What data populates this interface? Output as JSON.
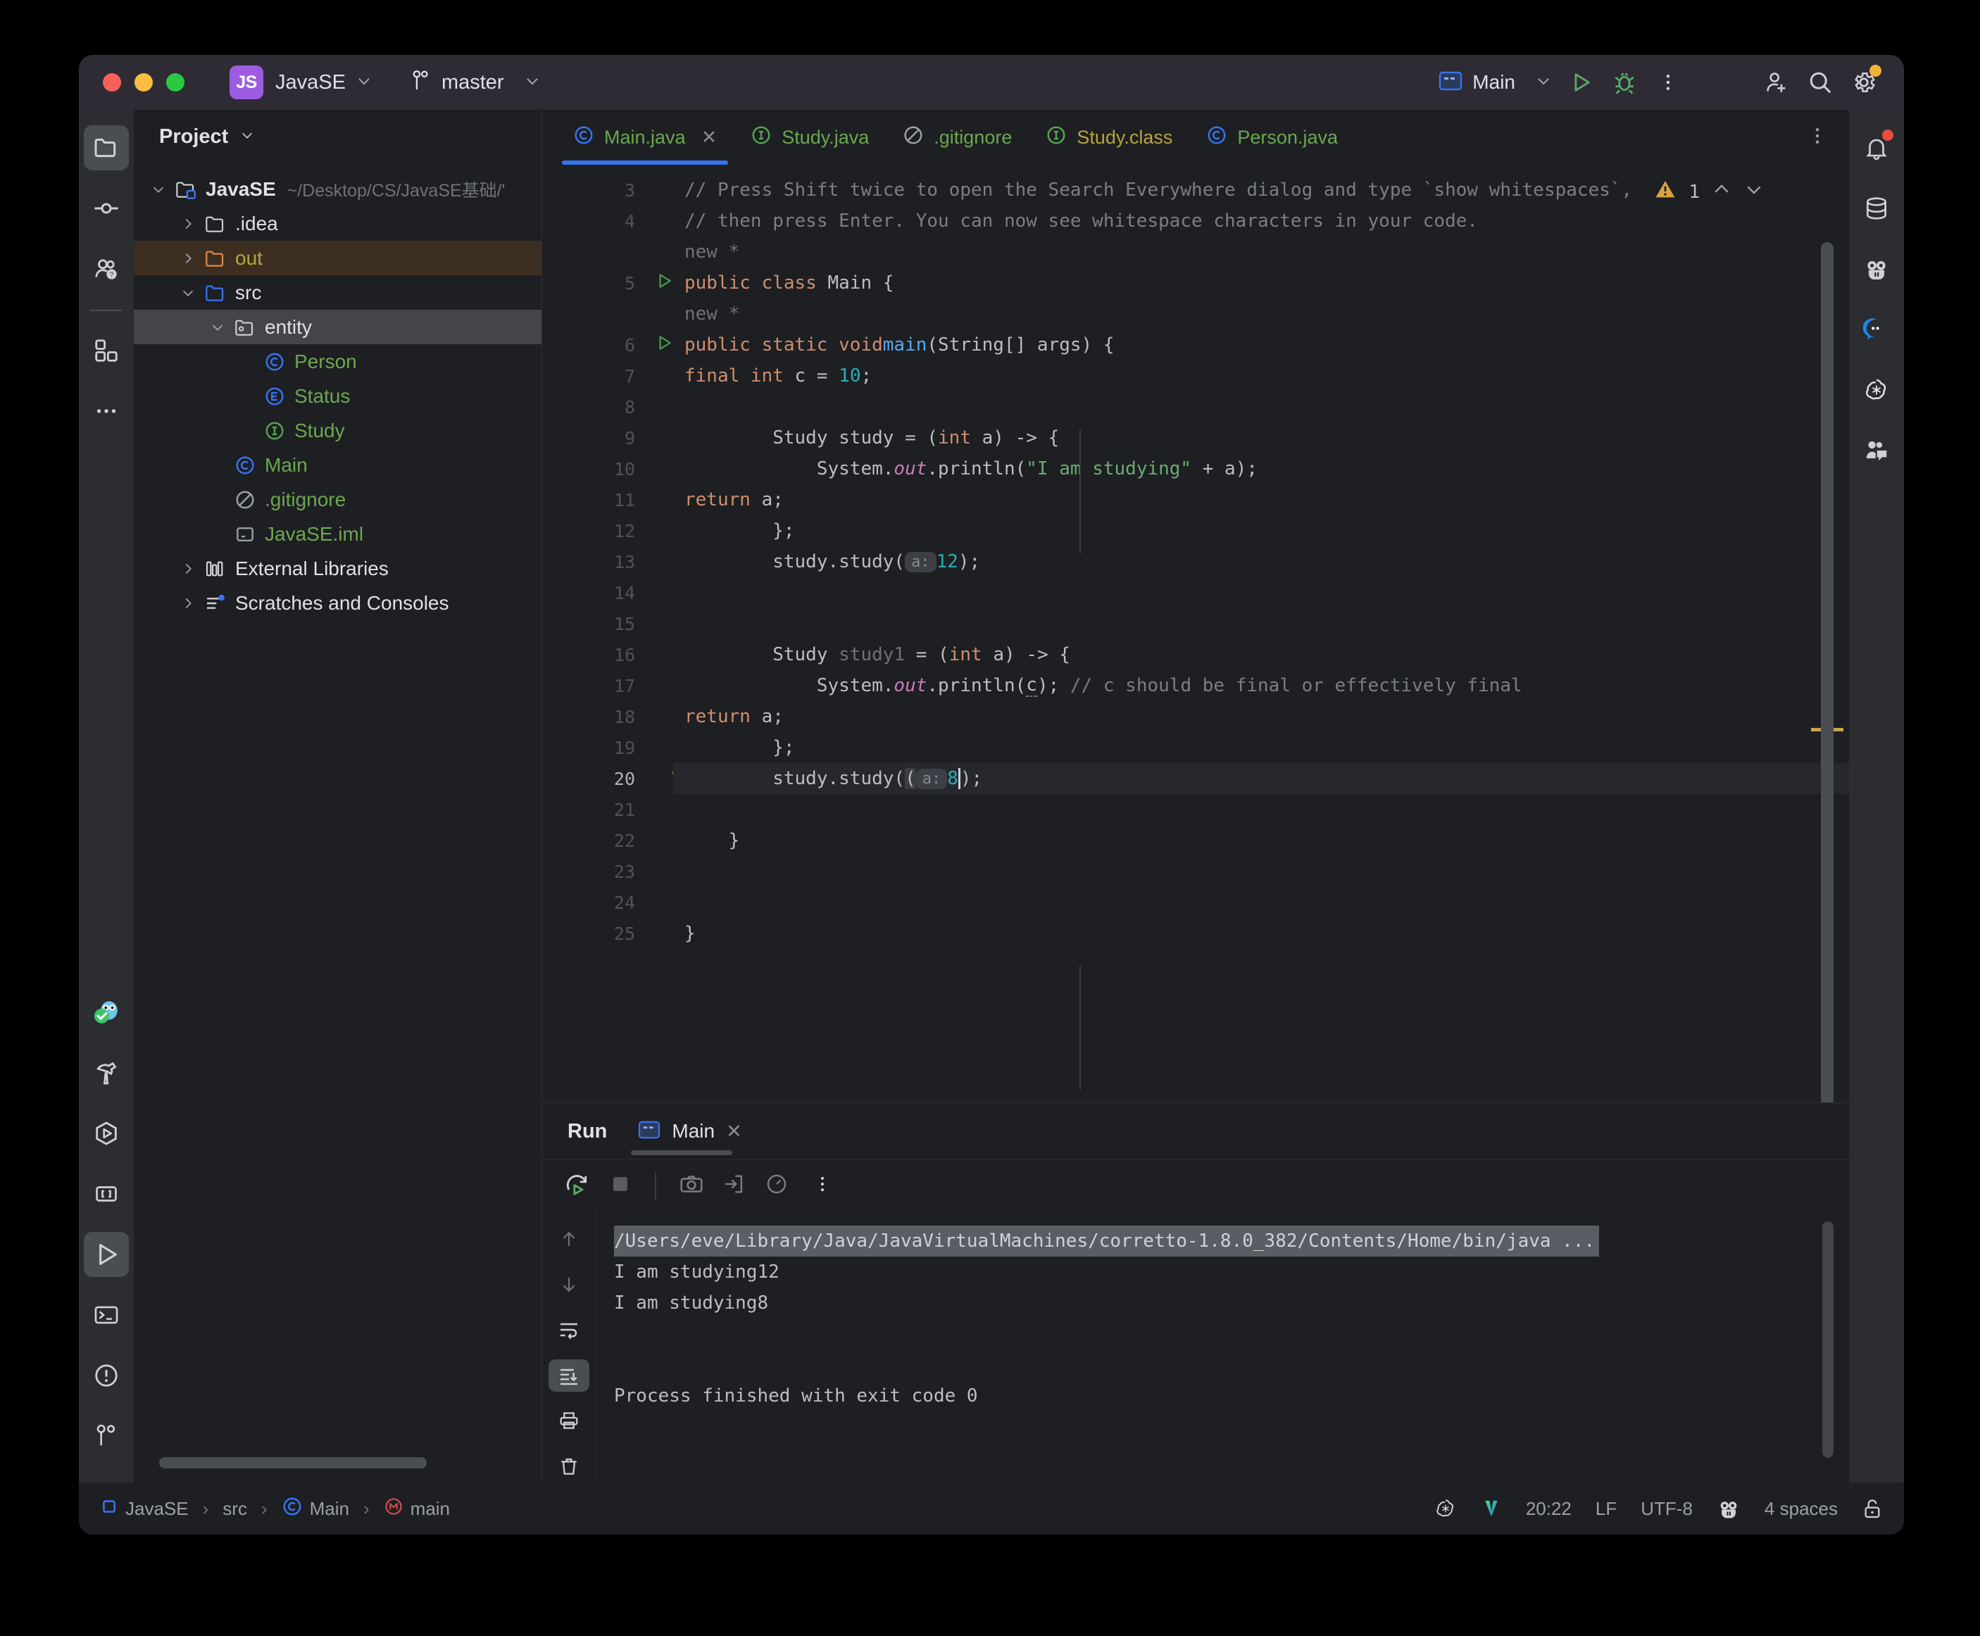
{
  "titlebar": {
    "project_badge": "JS",
    "project_name": "JavaSE",
    "branch": "master",
    "run_config": "Main",
    "icons": [
      "run-icon",
      "debug-icon",
      "more-options-icon",
      "add-user-icon",
      "search-icon",
      "settings-icon"
    ]
  },
  "left_rail": {
    "top_items": [
      "project-icon",
      "commit-icon",
      "ai-assistant-icon",
      "plugins-icon",
      "more-tool-windows-icon"
    ],
    "bottom_items": [
      "owl-icon",
      "build-icon",
      "run-anything-icon",
      "brackets-icon",
      "run-icon",
      "terminal-icon",
      "problems-icon",
      "git-icon"
    ]
  },
  "right_rail": {
    "items": [
      "notifications-icon",
      "database-icon",
      "codeium-icon",
      "chat-icon",
      "openai-icon",
      "ai-chat-icon"
    ]
  },
  "project": {
    "header": "Project",
    "tree": [
      {
        "label": "JavaSE",
        "path": "~/Desktop/CS/JavaSE基础/'",
        "icon": "project-folder-icon",
        "arrow": "down",
        "indent": 0,
        "color": "white",
        "bold": true
      },
      {
        "label": ".idea",
        "path": "",
        "icon": "folder-icon",
        "arrow": "right",
        "indent": 1,
        "color": "white",
        "bold": false
      },
      {
        "label": "out",
        "path": "",
        "icon": "folder-orange-icon",
        "arrow": "right",
        "indent": 1,
        "color": "olive",
        "bold": false,
        "highlight": "out"
      },
      {
        "label": "src",
        "path": "",
        "icon": "folder-source-icon",
        "arrow": "down",
        "indent": 1,
        "color": "white",
        "bold": false
      },
      {
        "label": "entity",
        "path": "",
        "icon": "package-icon",
        "arrow": "down",
        "indent": 2,
        "color": "white",
        "bold": false,
        "highlight": "selected"
      },
      {
        "label": "Person",
        "path": "",
        "icon": "class-icon",
        "arrow": "none",
        "indent": 3,
        "color": "green",
        "bold": false
      },
      {
        "label": "Status",
        "path": "",
        "icon": "enum-icon",
        "arrow": "none",
        "indent": 3,
        "color": "green",
        "bold": false
      },
      {
        "label": "Study",
        "path": "",
        "icon": "interface-icon",
        "arrow": "none",
        "indent": 3,
        "color": "green",
        "bold": false
      },
      {
        "label": "Main",
        "path": "",
        "icon": "class-icon",
        "arrow": "none",
        "indent": 2,
        "color": "green",
        "bold": false
      },
      {
        "label": ".gitignore",
        "path": "",
        "icon": "gitignore-icon",
        "arrow": "none",
        "indent": 2,
        "color": "green",
        "bold": false
      },
      {
        "label": "JavaSE.iml",
        "path": "",
        "icon": "iml-icon",
        "arrow": "none",
        "indent": 2,
        "color": "green",
        "bold": false
      },
      {
        "label": "External Libraries",
        "path": "",
        "icon": "library-icon",
        "arrow": "right",
        "indent": 1,
        "color": "white",
        "bold": false
      },
      {
        "label": "Scratches and Consoles",
        "path": "",
        "icon": "scratches-icon",
        "arrow": "right",
        "indent": 1,
        "color": "white",
        "bold": false
      }
    ]
  },
  "editor": {
    "tabs": [
      {
        "label": "Main.java",
        "icon": "class-icon",
        "color": "green",
        "active": true,
        "closable": true
      },
      {
        "label": "Study.java",
        "icon": "interface-icon",
        "color": "green",
        "active": false,
        "closable": false
      },
      {
        "label": ".gitignore",
        "icon": "gitignore-icon",
        "color": "green",
        "active": false,
        "closable": false
      },
      {
        "label": "Study.class",
        "icon": "interface-icon",
        "color": "olive",
        "active": false,
        "closable": false
      },
      {
        "label": "Person.java",
        "icon": "class-icon",
        "color": "green",
        "active": false,
        "closable": false
      }
    ],
    "inspection_count": "1",
    "first_visible_line": 3,
    "caret_line": 20,
    "lines": [
      {
        "n": 3,
        "html": "<span class='cmt'>// Press Shift twice to open the Search Everywhere dialog and type `show whitespaces`,</span>"
      },
      {
        "n": 4,
        "html": "<span class='cmt'>// then press Enter. You can now see whitespace characters in your code.</span>"
      },
      {
        "n": null,
        "html": "<span class='dim'>new *</span>"
      },
      {
        "n": 5,
        "html": "<span class='kw'>public class</span> Main {",
        "run": true
      },
      {
        "n": null,
        "html": "    <span class='dim'>new *</span>"
      },
      {
        "n": 6,
        "html": "    <span class='kw'>public static void</span> <span class='meth'>main</span>(String[] args) {",
        "run": true
      },
      {
        "n": 7,
        "html": "        <span class='kw'>final int</span> c = <span class='num'>10</span>;"
      },
      {
        "n": 8,
        "html": ""
      },
      {
        "n": 9,
        "html": "        Study study = (<span class='kw'>int</span> a) -&gt; {"
      },
      {
        "n": 10,
        "html": "            System.<span class='stat'>out</span>.println(<span class='str'>\"I am studying\"</span> + a);"
      },
      {
        "n": 11,
        "html": "            <span class='kw'>return</span> a;"
      },
      {
        "n": 12,
        "html": "        };"
      },
      {
        "n": 13,
        "html": "        study.study(<span class='hint'>a:</span> <span class='num'>12</span>);"
      },
      {
        "n": 14,
        "html": ""
      },
      {
        "n": 15,
        "html": ""
      },
      {
        "n": 16,
        "html": "        Study <span class='dim'>study1</span> = (<span class='kw'>int</span> a) -&gt; {"
      },
      {
        "n": 17,
        "html": "            System.<span class='stat'>out</span>.println(<span class='wavy'>c</span>); <span class='cmt'>// c should be final or effectively final</span>"
      },
      {
        "n": 18,
        "html": "            <span class='kw'>return</span> a;"
      },
      {
        "n": 19,
        "html": "        };"
      },
      {
        "n": 20,
        "html": "        study.study(<span class='sel-chip'>(</span><span class='hint'>a:</span> <span class='num'>8</span><span class='caret'></span>)<span class='sel-chip'></span>;",
        "cur": true,
        "bulb": true
      },
      {
        "n": 21,
        "html": ""
      },
      {
        "n": 22,
        "html": "    }"
      },
      {
        "n": 23,
        "html": ""
      },
      {
        "n": 24,
        "html": ""
      },
      {
        "n": 25,
        "html": "}"
      }
    ]
  },
  "run_panel": {
    "title": "Run",
    "tab_label": "Main",
    "toolbar": [
      "rerun-icon",
      "stop-icon",
      "camera-icon",
      "export-icon",
      "profiler-icon",
      "more-options-icon"
    ],
    "gutter": [
      "scroll-up-icon",
      "scroll-down-icon",
      "soft-wrap-icon",
      "scroll-to-end-icon",
      "print-icon",
      "clear-all-icon"
    ],
    "console": [
      {
        "text": "/Users/eve/Library/Java/JavaVirtualMachines/corretto-1.8.0_382/Contents/Home/bin/java ...",
        "highlight": true
      },
      {
        "text": "I am studying12",
        "highlight": false
      },
      {
        "text": "I am studying8",
        "highlight": false
      },
      {
        "text": "",
        "highlight": false
      },
      {
        "text": "",
        "highlight": false
      },
      {
        "text": "Process finished with exit code 0",
        "highlight": false
      }
    ]
  },
  "status_bar": {
    "breadcrumb": [
      {
        "label": "JavaSE",
        "icon": "module-icon"
      },
      {
        "label": "src",
        "icon": "none"
      },
      {
        "label": "Main",
        "icon": "class-icon"
      },
      {
        "label": "main",
        "icon": "method-icon"
      }
    ],
    "time": "20:22",
    "line_separator": "LF",
    "encoding": "UTF-8",
    "indent": "4 spaces",
    "right_icons": [
      "openai-icon",
      "vue-icon",
      "codeium-icon",
      "lock-icon"
    ]
  },
  "colors": {
    "accent": "#3574f0",
    "window_bg": "#1e1f22",
    "panel_bg": "#2b2d30",
    "titlebar_bg": "#2e2b35",
    "badge_purple": "#9d5ce0",
    "keyword": "#cf8e6d",
    "string": "#6aab73",
    "number": "#2aacb8",
    "comment": "#7a7e85",
    "method": "#56a8f5",
    "static_field": "#c77dbb",
    "warning": "#d9a343",
    "green_file": "#6aa84f",
    "olive_file": "#b5a53c"
  }
}
